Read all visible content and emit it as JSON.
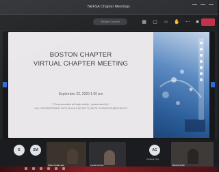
{
  "window": {
    "title": "NEFSA Chapter Meetings"
  },
  "toolbar": {
    "search_placeholder": "Bridget Connell",
    "icons": [
      "grid-icon",
      "chat-icon",
      "people-icon",
      "hand-icon",
      "more-icon",
      "camera-icon",
      "mic-icon",
      "share-icon"
    ],
    "leave_color": "#c4314b"
  },
  "slide": {
    "heading_line1": "BOSTON CHAPTER",
    "heading_line2": "VIRTUAL CHAPTER MEETING",
    "date": "September 22, 2020 1:00 pm",
    "note_line1": "**The presentation will begin shortly – please stand by**",
    "note_line2": "**ALL THE PARTICIPANT MIC'S SHOULD BE SET TO MUTE. PLEASE DOUBLECHECK**"
  },
  "participants": [
    {
      "initials": "E",
      "name": ""
    },
    {
      "initials": "SM",
      "name": ""
    },
    {
      "initials": "AC",
      "name": "Candela, Ana"
    },
    {
      "video_label": "Paulo Costa Leite"
    },
    {
      "video_label": "Lucas Ferreira"
    },
    {
      "video_label": "Bonnie Smith"
    }
  ]
}
